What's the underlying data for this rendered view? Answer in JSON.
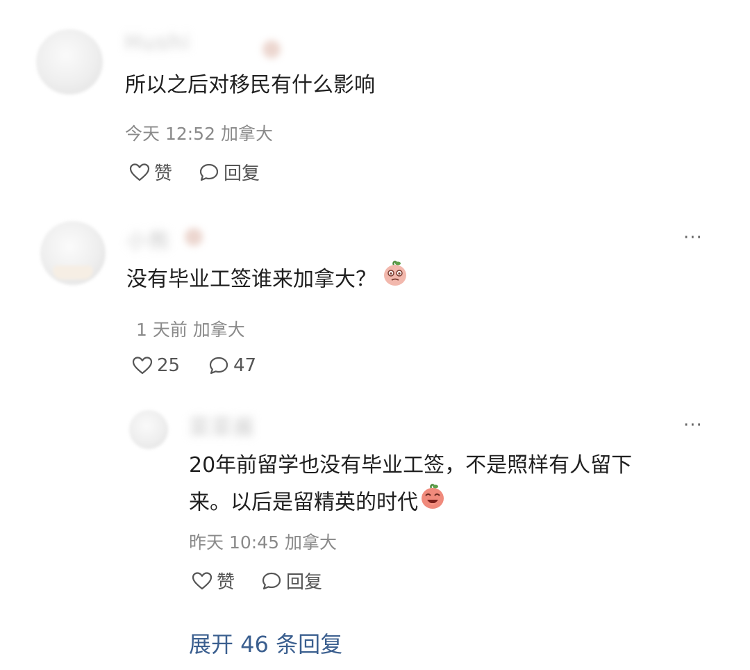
{
  "comments": [
    {
      "username": "Hushi",
      "text": "所以之后对移民有什么影响",
      "meta": "今天 12:52 加拿大",
      "like_label": "赞",
      "reply_label": "回复"
    },
    {
      "username": "小熊",
      "text": "没有毕业工签谁来加拿大？",
      "meta": "1 天前 加拿大",
      "like_label": "25",
      "reply_label": "47",
      "more_label": "···",
      "reply": {
        "username": "菜菜酱",
        "text_line1": "20年前留学也没有毕业工签，不是照样有人留下",
        "text_line2": "来。以后是留精英的时代",
        "meta": "昨天 10:45 加拿大",
        "like_label": "赞",
        "reply_label": "回复",
        "more_label": "···"
      }
    }
  ],
  "expand_replies_label": "展开 46 条回复",
  "colors": {
    "link": "#3b5f8f",
    "meta": "#8a8a8a",
    "text": "#1f1f1f"
  },
  "icons": {
    "like": "heart-outline-icon",
    "reply": "speech-bubble-icon",
    "more": "ellipsis-icon",
    "emoji": "peach-face-emoji"
  }
}
